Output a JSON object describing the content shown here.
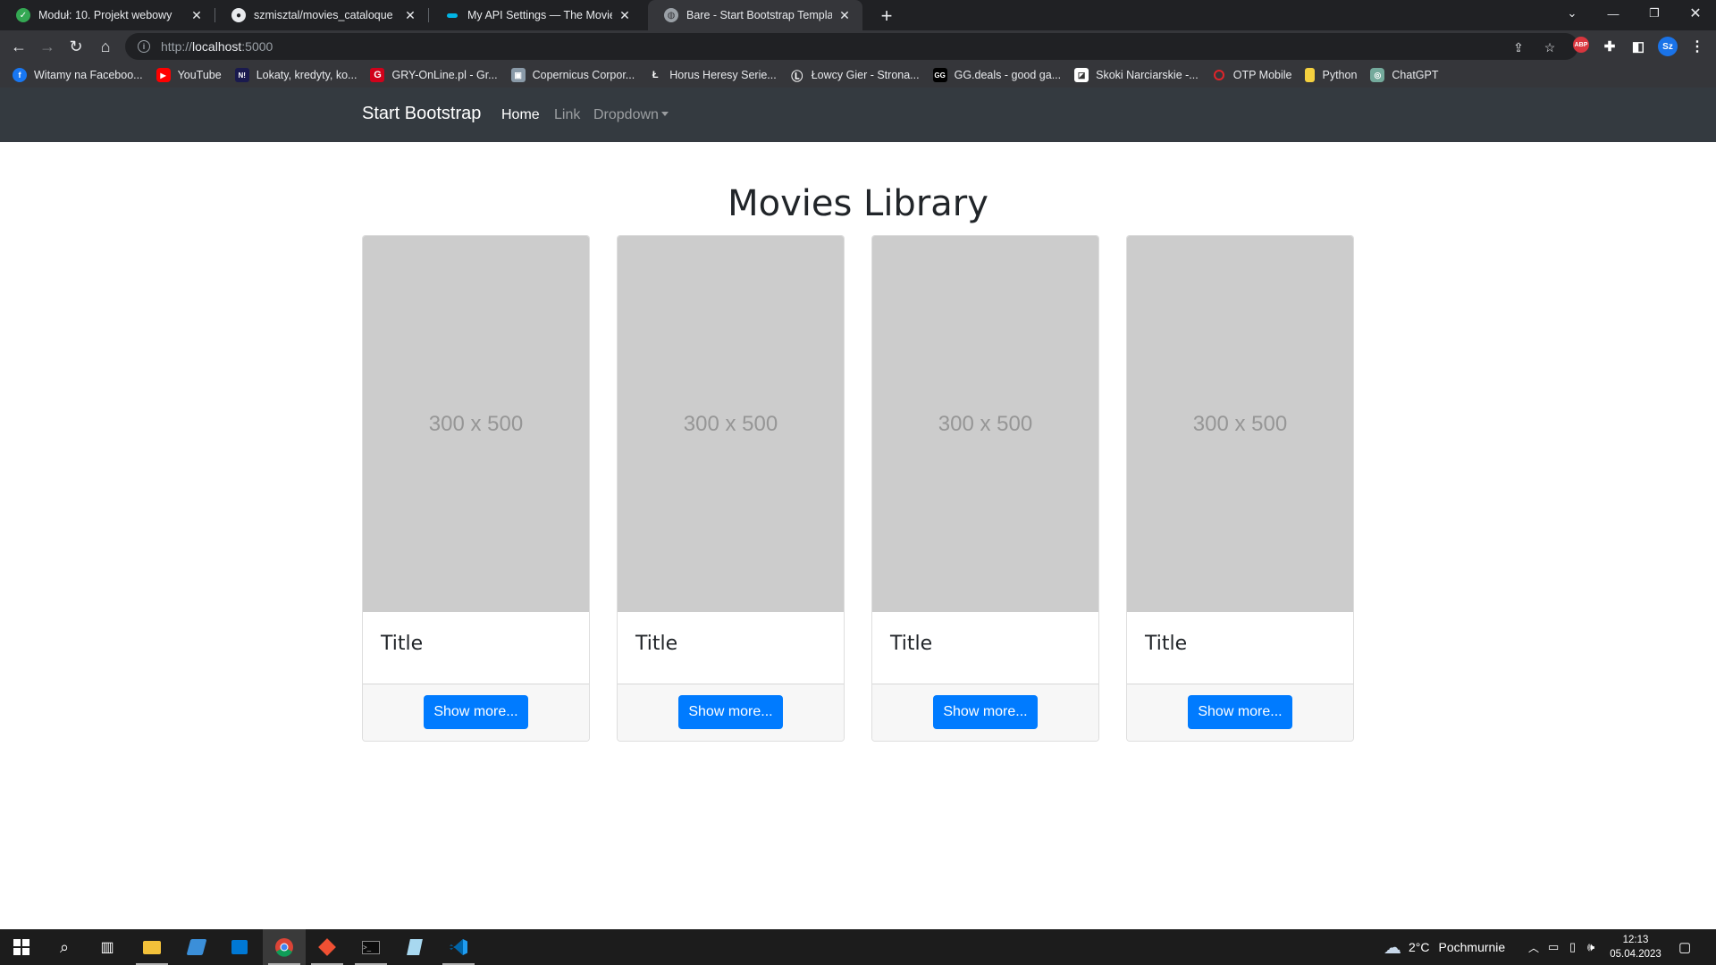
{
  "browser": {
    "tabs": [
      {
        "title": "Moduł: 10. Projekt webowy",
        "icon": "kodilla-check-icon",
        "color": "#34a853"
      },
      {
        "title": "szmisztal/movies_cataloque",
        "icon": "github-icon",
        "color": "#e8eaed"
      },
      {
        "title": "My API Settings — The Movie Da",
        "icon": "tmdb-icon",
        "color": "#01b4e4"
      },
      {
        "title": "Bare - Start Bootstrap Template",
        "icon": "globe-icon",
        "color": "#9aa0a6"
      }
    ],
    "url_prefix": "http://",
    "url_host": "localhost",
    "url_port": ":5000",
    "extension_abp": "ABP",
    "profile_initials": "Sz",
    "bookmarks": [
      {
        "label": "Witamy na Faceboo...",
        "icon": "f",
        "color": "#1877f2"
      },
      {
        "label": "YouTube",
        "icon": "▶",
        "color": "#ff0000"
      },
      {
        "label": "Lokaty, kredyty, ko...",
        "icon": "N!",
        "color": "#1a1a4e"
      },
      {
        "label": "GRY-OnLine.pl - Gr...",
        "icon": "G",
        "color": "#d0021b"
      },
      {
        "label": "Copernicus Corpor...",
        "icon": "▣",
        "color": "#8a9aa8"
      },
      {
        "label": "Horus Heresy Serie...",
        "icon": "Ł",
        "color": "#35363a"
      },
      {
        "label": "Łowcy Gier - Strona...",
        "icon": "Ⓛ",
        "color": "#35363a"
      },
      {
        "label": "GG.deals - good ga...",
        "icon": "GG",
        "color": "#000000"
      },
      {
        "label": "Skoki Narciarskie -...",
        "icon": "◪",
        "color": "#ffffff"
      },
      {
        "label": "OTP Mobile",
        "icon": "○",
        "color": "#35363a"
      },
      {
        "label": "Python",
        "icon": "▮",
        "color": "#f4d03f"
      },
      {
        "label": "ChatGPT",
        "icon": "◎",
        "color": "#74aa9c"
      }
    ]
  },
  "page": {
    "brand": "Start Bootstrap",
    "nav": [
      "Home",
      "Link",
      "Dropdown"
    ],
    "heading": "Movies Library",
    "cards": [
      {
        "placeholder": "300 x 500",
        "title": "Title",
        "button": "Show more..."
      },
      {
        "placeholder": "300 x 500",
        "title": "Title",
        "button": "Show more..."
      },
      {
        "placeholder": "300 x 500",
        "title": "Title",
        "button": "Show more..."
      },
      {
        "placeholder": "300 x 500",
        "title": "Title",
        "button": "Show more..."
      }
    ]
  },
  "taskbar": {
    "weather_temp": "2°C",
    "weather_desc": "Pochmurnie",
    "time": "12:13",
    "date": "05.04.2023"
  }
}
